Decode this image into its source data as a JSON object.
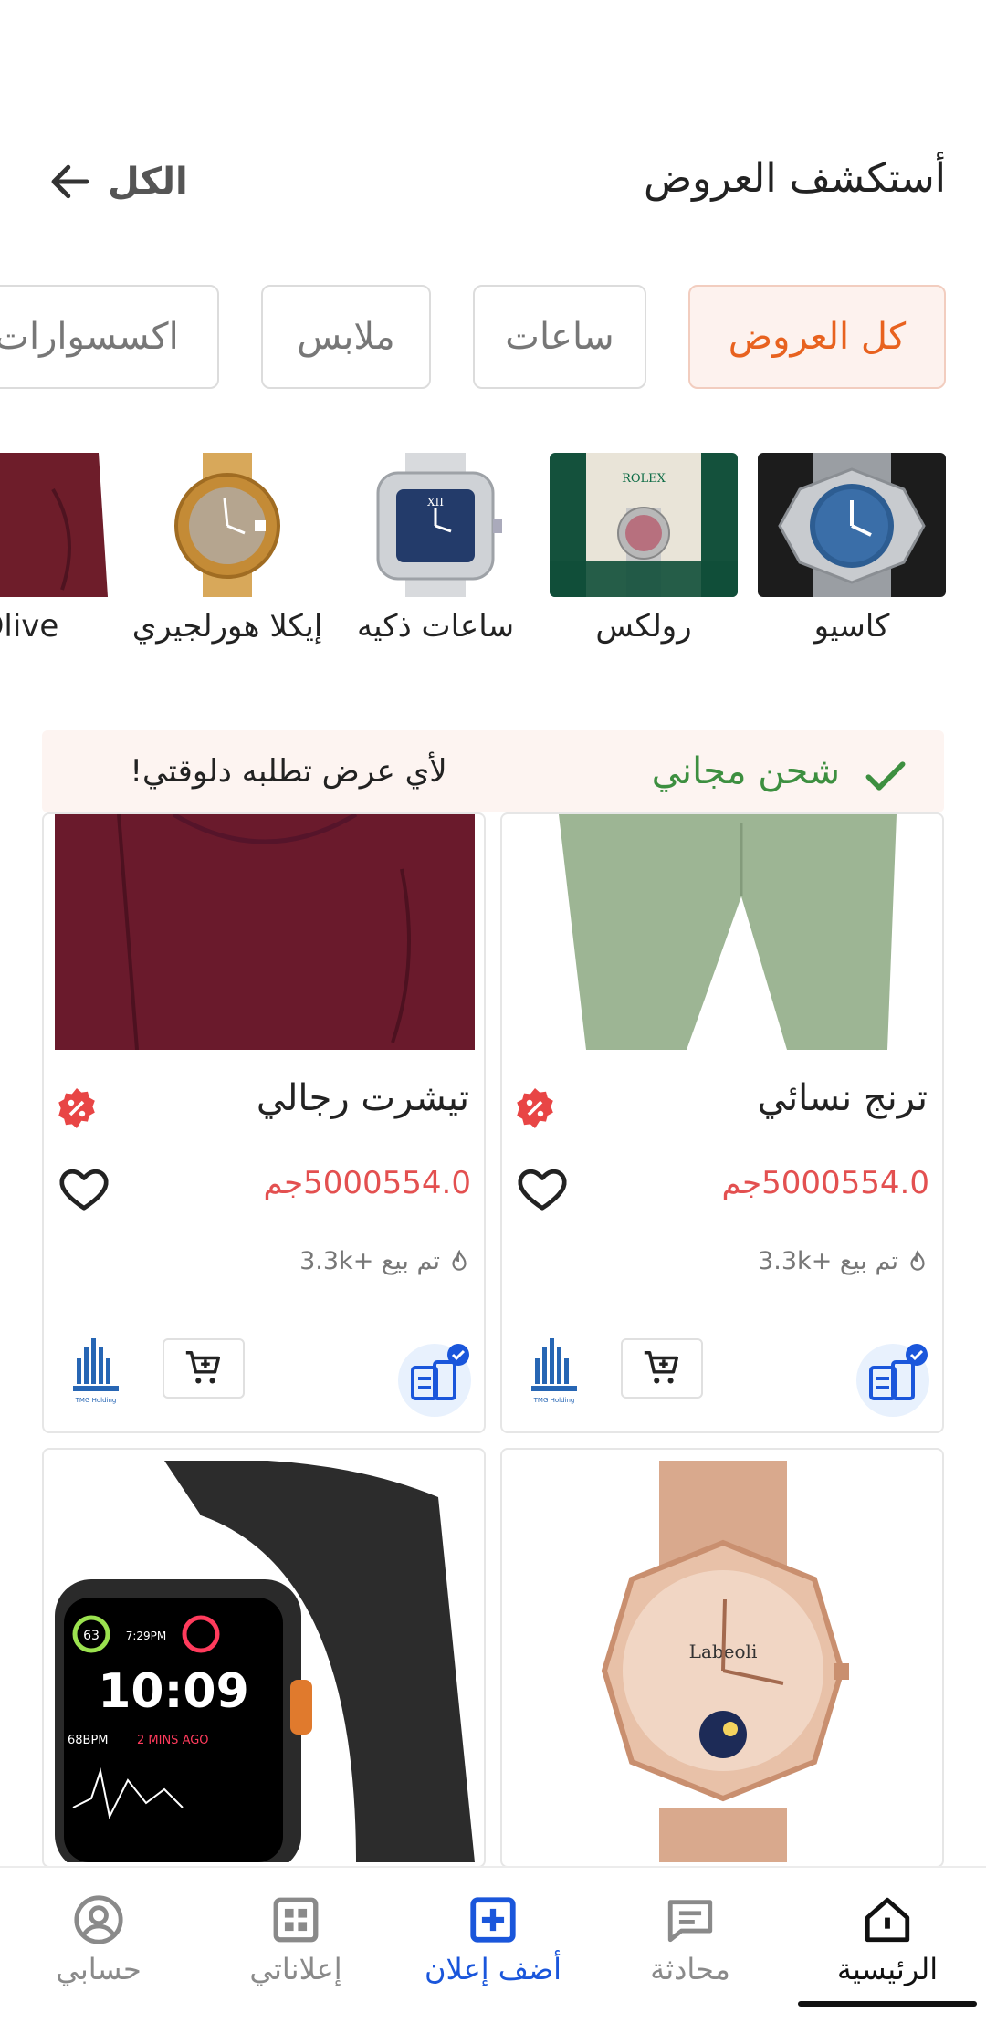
{
  "header": {
    "title": "أستكشف العروض",
    "see_all": "الكل"
  },
  "chips": [
    "كل العروض",
    "ساعات",
    "ملابس",
    "اكسسوارات"
  ],
  "brands": [
    {
      "name": "كاسيو",
      "icon": "watch-blue-dial"
    },
    {
      "name": "رولكس",
      "icon": "watch-rolex-box"
    },
    {
      "name": "ساعات ذكيه",
      "icon": "watch-square-silver"
    },
    {
      "name": "إيكلا هورلجيري",
      "icon": "watch-gold-ladies"
    },
    {
      "name": "Olive",
      "icon": "shirt-maroon"
    }
  ],
  "shipping": {
    "title": "شحن مجاني",
    "subtitle": "لأي عرض تطلبه دلوقتي!"
  },
  "products": [
    {
      "title": "ترنج نسائي",
      "price": "5000554.0جم",
      "sold": "تم بيع +3.3k",
      "photo": "pants-green"
    },
    {
      "title": "تيشرت رجالي",
      "price": "5000554.0جم",
      "sold": "تم بيع +3.3k",
      "photo": "shirt-maroon"
    },
    {
      "title": "",
      "price": "",
      "sold": "",
      "photo": "watch-rose-gold"
    },
    {
      "title": "",
      "price": "",
      "sold": "",
      "photo": "smartwatch-black"
    }
  ],
  "seller_logo_text": "TMG Holding",
  "smartwatch_screen": {
    "time": "10:09",
    "complication_1": "63",
    "complication_2": "7:29PM",
    "bpm": "68BPM",
    "ago": "2 MINS AGO"
  },
  "watch_brand_text": "Labeoli",
  "rolex_text": "ROLEX",
  "bottom_nav": [
    {
      "label": "الرئيسية",
      "icon": "home-icon"
    },
    {
      "label": "محادثة",
      "icon": "chat-icon"
    },
    {
      "label": "أضف إعلان",
      "icon": "add-square-icon"
    },
    {
      "label": "إعلاناتي",
      "icon": "grid-icon"
    },
    {
      "label": "حسابي",
      "icon": "account-icon"
    }
  ],
  "colors": {
    "accent": "#e8621f",
    "price": "#e35050",
    "shipping": "#3d8f40",
    "primary_blue": "#1a56db"
  }
}
